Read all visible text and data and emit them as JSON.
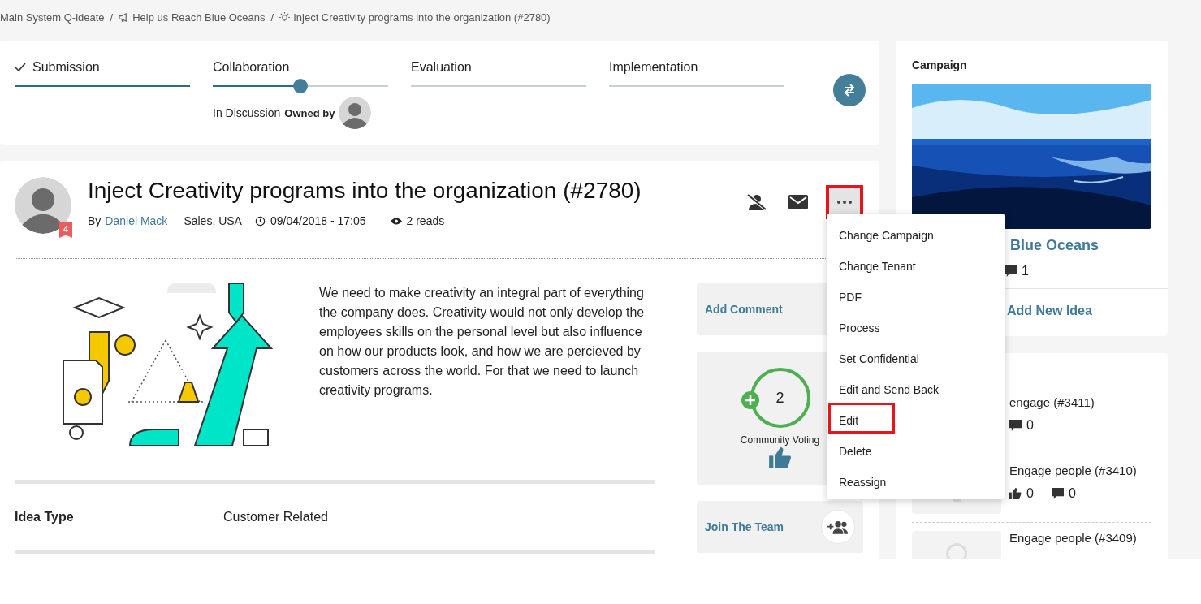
{
  "breadcrumb": [
    {
      "kind": "system",
      "label": "Main System Q-ideate",
      "separator": "/"
    },
    {
      "kind": "campaign",
      "label": "Help us Reach Blue Oceans",
      "separator": "/"
    },
    {
      "kind": "idea",
      "label": "Inject Creativity programs into the organization (#2780)"
    }
  ],
  "stepper": {
    "steps": [
      {
        "label": "Submission",
        "checked": true,
        "current": false,
        "level": 1
      },
      {
        "label": "Collaboration",
        "checked": false,
        "current": true,
        "level": 0.5
      },
      {
        "label": "Evaluation",
        "checked": false,
        "current": false,
        "level": 0
      },
      {
        "label": "Implementation",
        "checked": false,
        "current": false,
        "level": 0
      }
    ],
    "status": "In Discussion",
    "owner_label": "Owned by"
  },
  "idea": {
    "title": "Inject Creativity programs into the organization (#2780)",
    "author_prefix": "By",
    "author": "Daniel Mack",
    "location": "Sales, USA",
    "date": "09/04/2018 - 17:05",
    "reads": "2 reads",
    "badge": "4",
    "description": "We need to make creativity an integral part of everything the company does. Creativity would not only develop the employees skills on the personal level but also influence on how our products look, and how we are percieved by customers across the world. For that we need to launch creativity programs.",
    "fields": [
      {
        "label": "Idea Type",
        "value": "Customer Related"
      }
    ],
    "actions": [
      {
        "kind": "comment",
        "label": "Add Comment"
      },
      {
        "kind": "voting",
        "count": "2",
        "label": "Community Voting"
      },
      {
        "kind": "team",
        "label": "Join The Team"
      }
    ],
    "more_menu": {
      "highlighted": true,
      "items": [
        {
          "label": "Change Campaign",
          "highlighted": false
        },
        {
          "label": "Change Tenant",
          "highlighted": false
        },
        {
          "label": "PDF",
          "highlighted": false
        },
        {
          "label": "Process",
          "highlighted": false
        },
        {
          "label": "Set Confidential",
          "highlighted": false
        },
        {
          "label": "Edit and Send Back",
          "highlighted": false
        },
        {
          "label": "Edit",
          "highlighted": true
        },
        {
          "label": "Delete",
          "highlighted": false
        },
        {
          "label": "Reassign",
          "highlighted": false
        }
      ]
    }
  },
  "campaign": {
    "heading": "Campaign",
    "title": "Blue Oceans",
    "comments": "1",
    "add_link": "Add New Idea"
  },
  "ideas": [
    {
      "title": "engage (#3411)",
      "comments": "0"
    },
    {
      "title": "Engage people (#3410)",
      "thumbnail": true,
      "likes": "0",
      "comments": "0"
    },
    {
      "title": "Engage people (#3409)",
      "thumbnail": true
    }
  ]
}
